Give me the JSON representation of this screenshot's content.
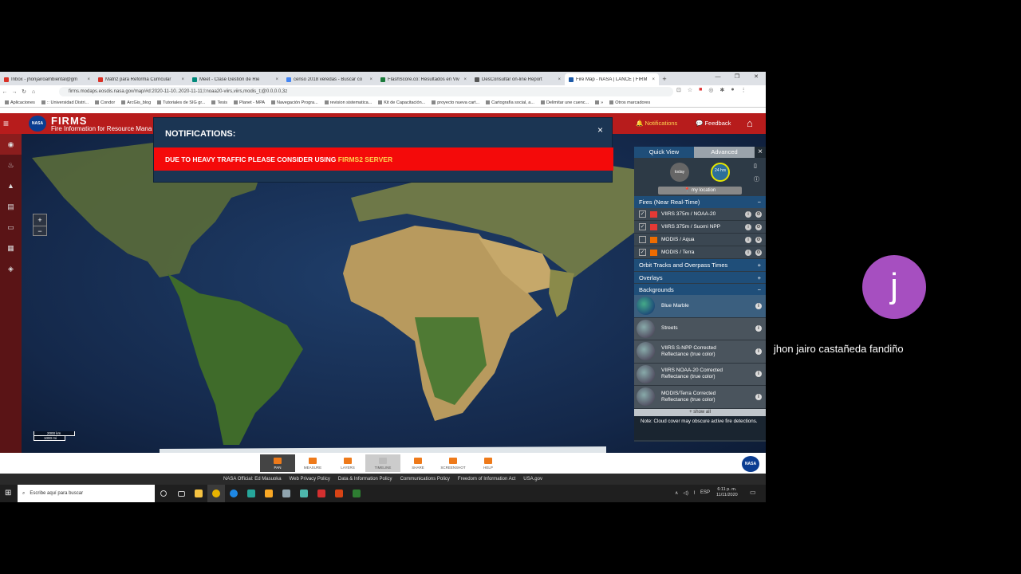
{
  "browser": {
    "tabs": [
      {
        "label": "Inbox - jhonjairoambiental@gm",
        "color": "#d93025"
      },
      {
        "label": "Matriz para Reforma Curricular",
        "color": "#d93025"
      },
      {
        "label": "Meet - Clase Gestión de Rie",
        "color": "#00897b"
      },
      {
        "label": "censo 2018 veredas - Buscar co",
        "color": "#4285f4"
      },
      {
        "label": "FlashScore.co: Resultados en Viv",
        "color": "#1a7a3a"
      },
      {
        "label": "DesConsultar on-line Report",
        "color": "#555555"
      },
      {
        "label": "Fire Map - NASA | LANCE | FIRM",
        "color": "#1e5ba8"
      }
    ],
    "tab_close": "×",
    "new_tab": "+",
    "url": "firms.modaps.eosdis.nasa.gov/map/#d:2020-11-10..2020-11-11;l:noaa20-viirs,viirs,modis_t;@0.0,0.0,3z",
    "bookmarks": [
      "Aplicaciones",
      ":: Universidad Distri...",
      "Condor",
      "ArcGis_blog",
      "Tutoriales de SIG gr...",
      "Tesis",
      "Planet - MPA",
      "Navegación Progra...",
      "revision sistematica...",
      "Kit de Capacitación...",
      "proyecto nueva cart...",
      "Cartografía social, a...",
      "Delimitar une cuenc...",
      "»",
      "Otros marcadores"
    ]
  },
  "firms": {
    "logo": "NASA",
    "title": "FIRMS",
    "subtitle": "Fire Information for Resource Mana",
    "notifications_label": "Notifications",
    "feedback_label": "Feedback"
  },
  "notification": {
    "title": "NOTIFICATIONS:",
    "close": "×",
    "message_prefix": "DUE TO HEAVY TRAFFIC PLEASE CONSIDER USING ",
    "message_link": "FIRMS2 SERVER"
  },
  "map": {
    "zoom_in": "+",
    "zoom_out": "−",
    "scale_top": "2000 km",
    "scale_bottom": "1000 mi"
  },
  "panel": {
    "tab_quick": "Quick View",
    "tab_advanced": "Advanced",
    "close": "×",
    "today": "today",
    "hrs_24": "24 hrs",
    "my_location": "my location",
    "fires_section": "Fires (Near Real-Time)",
    "fire_layers": [
      {
        "label": "VIIRS 375m / NOAA-20",
        "color": "#e53935",
        "checked": true
      },
      {
        "label": "VIIRS 375m / Suomi NPP",
        "color": "#e53935",
        "checked": true
      },
      {
        "label": "MODIS / Aqua",
        "color": "#ef6c00",
        "checked": false
      },
      {
        "label": "MODIS / Terra",
        "color": "#ef6c00",
        "checked": true
      }
    ],
    "orbit_section": "Orbit Tracks and Overpass Times",
    "overlays_section": "Overlays",
    "backgrounds_section": "Backgrounds",
    "backgrounds": [
      "Blue Marble",
      "Streets",
      "VIIRS S-NPP Corrected Reflectance (true color)",
      "VIIRS NOAA-20 Corrected Reflectance (true color)",
      "MODIS/Terra Corrected Reflectance (true color)"
    ],
    "show_all": "+ show all",
    "note": "Note: Cloud cover may obscure active fire detections."
  },
  "toolbar": [
    "PAN",
    "MEASURE",
    "LAYERS",
    "TIMELINE",
    "SHARE",
    "SCREENSHOT",
    "HELP"
  ],
  "footer": [
    "NASA Official: Ed Masuoka",
    "Web Privacy Policy",
    "Data & Information Policy",
    "Communications Policy",
    "Freedom of Information Act",
    "USA.gov"
  ],
  "taskbar": {
    "search_placeholder": "Escribe aquí para buscar",
    "lang": "ESP",
    "time": "6:11 p. m.",
    "date": "11/11/2020"
  },
  "participant": {
    "initial": "j",
    "name": "jhon jairo castañeda fandiño"
  }
}
